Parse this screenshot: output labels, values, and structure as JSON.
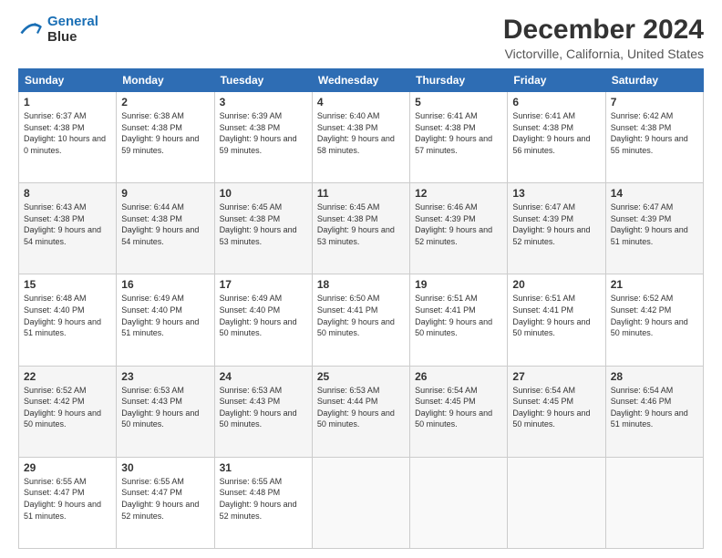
{
  "logo": {
    "line1": "General",
    "line2": "Blue"
  },
  "title": "December 2024",
  "subtitle": "Victorville, California, United States",
  "days_of_week": [
    "Sunday",
    "Monday",
    "Tuesday",
    "Wednesday",
    "Thursday",
    "Friday",
    "Saturday"
  ],
  "weeks": [
    [
      {
        "day": "1",
        "sunrise": "6:37 AM",
        "sunset": "4:38 PM",
        "daylight": "10 hours and 0 minutes."
      },
      {
        "day": "2",
        "sunrise": "6:38 AM",
        "sunset": "4:38 PM",
        "daylight": "9 hours and 59 minutes."
      },
      {
        "day": "3",
        "sunrise": "6:39 AM",
        "sunset": "4:38 PM",
        "daylight": "9 hours and 59 minutes."
      },
      {
        "day": "4",
        "sunrise": "6:40 AM",
        "sunset": "4:38 PM",
        "daylight": "9 hours and 58 minutes."
      },
      {
        "day": "5",
        "sunrise": "6:41 AM",
        "sunset": "4:38 PM",
        "daylight": "9 hours and 57 minutes."
      },
      {
        "day": "6",
        "sunrise": "6:41 AM",
        "sunset": "4:38 PM",
        "daylight": "9 hours and 56 minutes."
      },
      {
        "day": "7",
        "sunrise": "6:42 AM",
        "sunset": "4:38 PM",
        "daylight": "9 hours and 55 minutes."
      }
    ],
    [
      {
        "day": "8",
        "sunrise": "6:43 AM",
        "sunset": "4:38 PM",
        "daylight": "9 hours and 54 minutes."
      },
      {
        "day": "9",
        "sunrise": "6:44 AM",
        "sunset": "4:38 PM",
        "daylight": "9 hours and 54 minutes."
      },
      {
        "day": "10",
        "sunrise": "6:45 AM",
        "sunset": "4:38 PM",
        "daylight": "9 hours and 53 minutes."
      },
      {
        "day": "11",
        "sunrise": "6:45 AM",
        "sunset": "4:38 PM",
        "daylight": "9 hours and 53 minutes."
      },
      {
        "day": "12",
        "sunrise": "6:46 AM",
        "sunset": "4:39 PM",
        "daylight": "9 hours and 52 minutes."
      },
      {
        "day": "13",
        "sunrise": "6:47 AM",
        "sunset": "4:39 PM",
        "daylight": "9 hours and 52 minutes."
      },
      {
        "day": "14",
        "sunrise": "6:47 AM",
        "sunset": "4:39 PM",
        "daylight": "9 hours and 51 minutes."
      }
    ],
    [
      {
        "day": "15",
        "sunrise": "6:48 AM",
        "sunset": "4:40 PM",
        "daylight": "9 hours and 51 minutes."
      },
      {
        "day": "16",
        "sunrise": "6:49 AM",
        "sunset": "4:40 PM",
        "daylight": "9 hours and 51 minutes."
      },
      {
        "day": "17",
        "sunrise": "6:49 AM",
        "sunset": "4:40 PM",
        "daylight": "9 hours and 50 minutes."
      },
      {
        "day": "18",
        "sunrise": "6:50 AM",
        "sunset": "4:41 PM",
        "daylight": "9 hours and 50 minutes."
      },
      {
        "day": "19",
        "sunrise": "6:51 AM",
        "sunset": "4:41 PM",
        "daylight": "9 hours and 50 minutes."
      },
      {
        "day": "20",
        "sunrise": "6:51 AM",
        "sunset": "4:41 PM",
        "daylight": "9 hours and 50 minutes."
      },
      {
        "day": "21",
        "sunrise": "6:52 AM",
        "sunset": "4:42 PM",
        "daylight": "9 hours and 50 minutes."
      }
    ],
    [
      {
        "day": "22",
        "sunrise": "6:52 AM",
        "sunset": "4:42 PM",
        "daylight": "9 hours and 50 minutes."
      },
      {
        "day": "23",
        "sunrise": "6:53 AM",
        "sunset": "4:43 PM",
        "daylight": "9 hours and 50 minutes."
      },
      {
        "day": "24",
        "sunrise": "6:53 AM",
        "sunset": "4:43 PM",
        "daylight": "9 hours and 50 minutes."
      },
      {
        "day": "25",
        "sunrise": "6:53 AM",
        "sunset": "4:44 PM",
        "daylight": "9 hours and 50 minutes."
      },
      {
        "day": "26",
        "sunrise": "6:54 AM",
        "sunset": "4:45 PM",
        "daylight": "9 hours and 50 minutes."
      },
      {
        "day": "27",
        "sunrise": "6:54 AM",
        "sunset": "4:45 PM",
        "daylight": "9 hours and 50 minutes."
      },
      {
        "day": "28",
        "sunrise": "6:54 AM",
        "sunset": "4:46 PM",
        "daylight": "9 hours and 51 minutes."
      }
    ],
    [
      {
        "day": "29",
        "sunrise": "6:55 AM",
        "sunset": "4:47 PM",
        "daylight": "9 hours and 51 minutes."
      },
      {
        "day": "30",
        "sunrise": "6:55 AM",
        "sunset": "4:47 PM",
        "daylight": "9 hours and 52 minutes."
      },
      {
        "day": "31",
        "sunrise": "6:55 AM",
        "sunset": "4:48 PM",
        "daylight": "9 hours and 52 minutes."
      },
      null,
      null,
      null,
      null
    ]
  ]
}
